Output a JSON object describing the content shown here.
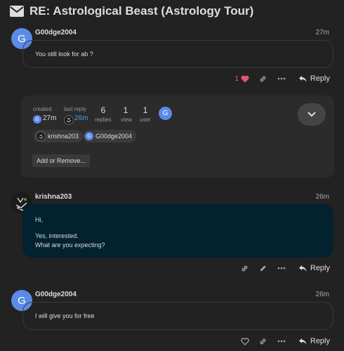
{
  "topic": {
    "title": "RE: Astrological Beast (Astrology Tour)"
  },
  "posts": [
    {
      "avatar_letter": "G",
      "username": "G00dge2004",
      "time": "27m",
      "body": [
        "You still look for ab ?"
      ],
      "likes": "1",
      "reply_label": "Reply"
    },
    {
      "username": "krishna203",
      "time": "26m",
      "body": [
        "Hi,",
        "Yes, interested.",
        "What are you expecting?"
      ],
      "reply_label": "Reply"
    },
    {
      "avatar_letter": "G",
      "username": "G00dge2004",
      "time": "26m",
      "body": [
        "I will give you for free"
      ],
      "reply_label": "Reply"
    }
  ],
  "summary": {
    "created_label": "created",
    "created_time": "27m",
    "created_avatar": "G",
    "last_reply_label": "last reply",
    "last_reply_time": "26m",
    "replies_count": "6",
    "replies_label": "replies",
    "views_count": "1",
    "views_label": "view",
    "users_count": "1",
    "users_label": "user",
    "user_avatar": "G",
    "participants": [
      {
        "name": "krishna203"
      },
      {
        "name": "G00dge2004",
        "letter": "G"
      }
    ],
    "add_remove_label": "Add or Remove..."
  },
  "colors": {
    "background": "#222222",
    "avatar_blue": "#5b8be6",
    "highlight_post": "#022230",
    "like_heart": "#e45575",
    "link_blue": "#4aa3df"
  },
  "icons": [
    "envelope-icon",
    "heart-icon",
    "link-icon",
    "more-icon",
    "reply-icon",
    "chevron-down-icon",
    "pencil-icon"
  ]
}
